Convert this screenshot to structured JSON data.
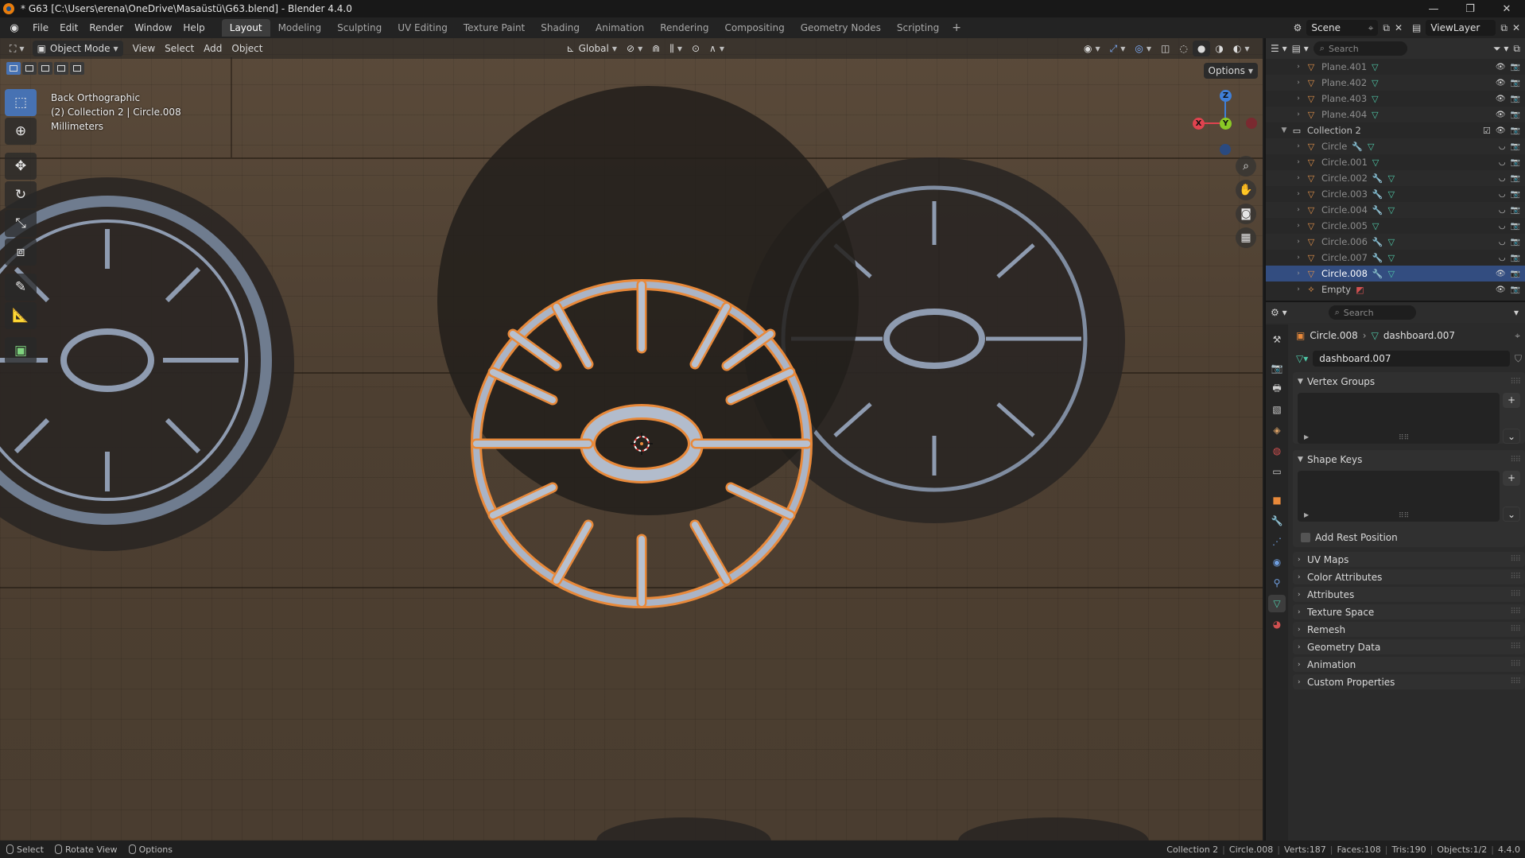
{
  "window": {
    "title": "* G63 [C:\\Users\\erena\\OneDrive\\Masaüstü\\G63.blend] - Blender 4.4.0",
    "minimize": "—",
    "maximize": "❐",
    "close": "✕"
  },
  "menu": [
    "File",
    "Edit",
    "Render",
    "Window",
    "Help"
  ],
  "workspaces": [
    "Layout",
    "Modeling",
    "Sculpting",
    "UV Editing",
    "Texture Paint",
    "Shading",
    "Animation",
    "Rendering",
    "Compositing",
    "Geometry Nodes",
    "Scripting"
  ],
  "workspace_add": "+",
  "scene": {
    "scene_name": "Scene",
    "view_layer": "ViewLayer"
  },
  "viewport": {
    "mode": "Object Mode",
    "menus": [
      "View",
      "Select",
      "Add",
      "Object"
    ],
    "transform_orientation": "Global",
    "options": "Options",
    "info": [
      "Back Orthographic",
      "(2) Collection 2 | Circle.008",
      "Millimeters"
    ],
    "gizmo": {
      "x": "X",
      "y": "Y",
      "z": "Z"
    }
  },
  "outliner": {
    "search_placeholder": "Search",
    "rows": [
      {
        "name": "Plane.401",
        "kind": "object",
        "selected": false
      },
      {
        "name": "Plane.402",
        "kind": "object",
        "selected": false
      },
      {
        "name": "Plane.403",
        "kind": "object",
        "selected": false
      },
      {
        "name": "Plane.404",
        "kind": "object",
        "selected": false
      },
      {
        "name": "Collection 2",
        "kind": "collection",
        "selected": false
      },
      {
        "name": "Circle",
        "kind": "object",
        "selected": false
      },
      {
        "name": "Circle.001",
        "kind": "object",
        "selected": false
      },
      {
        "name": "Circle.002",
        "kind": "object",
        "selected": false
      },
      {
        "name": "Circle.003",
        "kind": "object",
        "selected": false
      },
      {
        "name": "Circle.004",
        "kind": "object",
        "selected": false
      },
      {
        "name": "Circle.005",
        "kind": "object",
        "selected": false
      },
      {
        "name": "Circle.006",
        "kind": "object",
        "selected": false
      },
      {
        "name": "Circle.007",
        "kind": "object",
        "selected": false
      },
      {
        "name": "Circle.008",
        "kind": "object",
        "selected": true
      },
      {
        "name": "Empty",
        "kind": "empty",
        "selected": false
      }
    ]
  },
  "properties": {
    "search_placeholder": "Search",
    "breadcrumb_object": "Circle.008",
    "breadcrumb_data": "dashboard.007",
    "mesh_datablock": "dashboard.007",
    "panels": {
      "vertex_groups": "Vertex Groups",
      "shape_keys": "Shape Keys",
      "add_rest_position": "Add Rest Position",
      "collapsed": [
        "UV Maps",
        "Color Attributes",
        "Attributes",
        "Texture Space",
        "Remesh",
        "Geometry Data",
        "Animation",
        "Custom Properties"
      ]
    }
  },
  "statusbar": {
    "select": "Select",
    "rotate_view": "Rotate View",
    "options": "Options",
    "stats": [
      "Collection 2",
      "Circle.008",
      "Verts:187",
      "Faces:108",
      "Tris:190",
      "Objects:1/2",
      "4.4.0"
    ]
  },
  "colors": {
    "accent_selected": "#334d80",
    "active_tool": "#4772b3",
    "outline_orange": "#e8893a",
    "axis_x": "#e0434f",
    "axis_y": "#8ac926",
    "axis_z": "#3f7fd8"
  }
}
